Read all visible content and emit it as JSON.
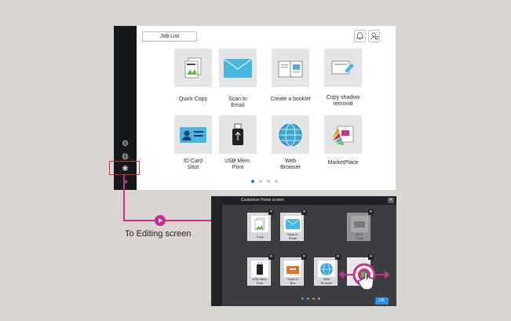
{
  "toolbar": {
    "job_list_label": "Job List",
    "bell_icon": "bell-icon",
    "user_icon": "user-status-icon"
  },
  "sidebar": {
    "icons": [
      "settings-icon",
      "globe-icon",
      "puzzle-icon",
      "double-chevron-icon"
    ]
  },
  "tiles": [
    {
      "label": "Quick Copy",
      "icon": "copy-icon"
    },
    {
      "label": "Scan to\nEmail",
      "icon": "envelope-icon"
    },
    {
      "label": "Create a booklet",
      "icon": "booklet-icon"
    },
    {
      "label": "Copy shadow\nremoval",
      "icon": "shadow-removal-icon"
    },
    {
      "label": "ID Card\nShot",
      "icon": "id-card-icon"
    },
    {
      "label": "USB Mem.\nPrint",
      "icon": "usb-icon"
    },
    {
      "label": "Web\nBrowser",
      "icon": "globe-icon"
    },
    {
      "label": "MarketPlace",
      "icon": "marketplace-icon"
    }
  ],
  "page_dots": {
    "count": 4,
    "active": 0
  },
  "connector": {
    "caption": "To Editing screen",
    "color": "#c5308e"
  },
  "edit_screen": {
    "title": "Customize Home screen",
    "close_label": "✕",
    "tiles": [
      {
        "label": "Copy",
        "icon": "copy-icon"
      },
      {
        "label": "Scan to\nEmail",
        "icon": "envelope-icon"
      },
      {
        "label": "ID &\nPrint",
        "icon": "id-print-icon"
      },
      {
        "label": "USB Mem.\nPrint",
        "icon": "usb-icon"
      },
      {
        "label": "Scan to\nBox",
        "icon": "box-icon"
      },
      {
        "label": "Web\nBrowser",
        "icon": "globe-icon"
      }
    ],
    "ok_label": "OK",
    "dot_count": 4
  },
  "colors": {
    "accent": "#c5308e",
    "highlight": "#d9312f",
    "active_dot": "#1c7fd8",
    "sidebar": "#15181c"
  }
}
